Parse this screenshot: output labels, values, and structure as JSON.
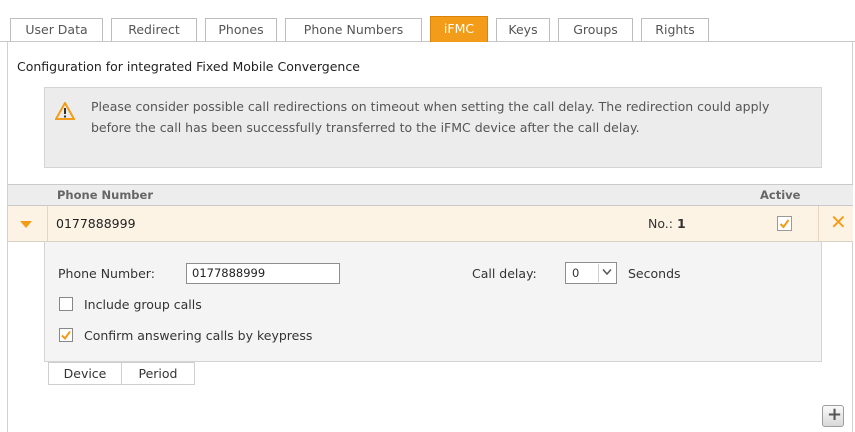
{
  "tabs": [
    {
      "label": "User Data"
    },
    {
      "label": "Redirect"
    },
    {
      "label": "Phones"
    },
    {
      "label": "Phone Numbers"
    },
    {
      "label": "iFMC"
    },
    {
      "label": "Keys"
    },
    {
      "label": "Groups"
    },
    {
      "label": "Rights"
    }
  ],
  "active_tab": "iFMC",
  "accent_color": "#f39c19",
  "page_title": "Configuration for integrated Fixed Mobile Convergence",
  "warning": {
    "icon": "warning-triangle-icon",
    "text": "Please consider possible call redirections on timeout when setting the call delay. The redirection could apply before the call has been successfully transferred to the iFMC device after the call delay."
  },
  "grid": {
    "col_phone": "Phone Number",
    "col_active": "Active",
    "rows": [
      {
        "number": "0177888999",
        "no_label": "No.:",
        "no_value": "1",
        "active": true
      }
    ]
  },
  "detail": {
    "phone_label": "Phone Number:",
    "phone_value": "0177888999",
    "delay_label": "Call delay:",
    "delay_value": "0",
    "delay_unit": "Seconds",
    "include_group_label": "Include group calls",
    "include_group_checked": false,
    "confirm_label": "Confirm answering calls by keypress",
    "confirm_checked": true
  },
  "sub_tabs": [
    {
      "label": "Device"
    },
    {
      "label": "Period"
    }
  ],
  "add_button": "+"
}
